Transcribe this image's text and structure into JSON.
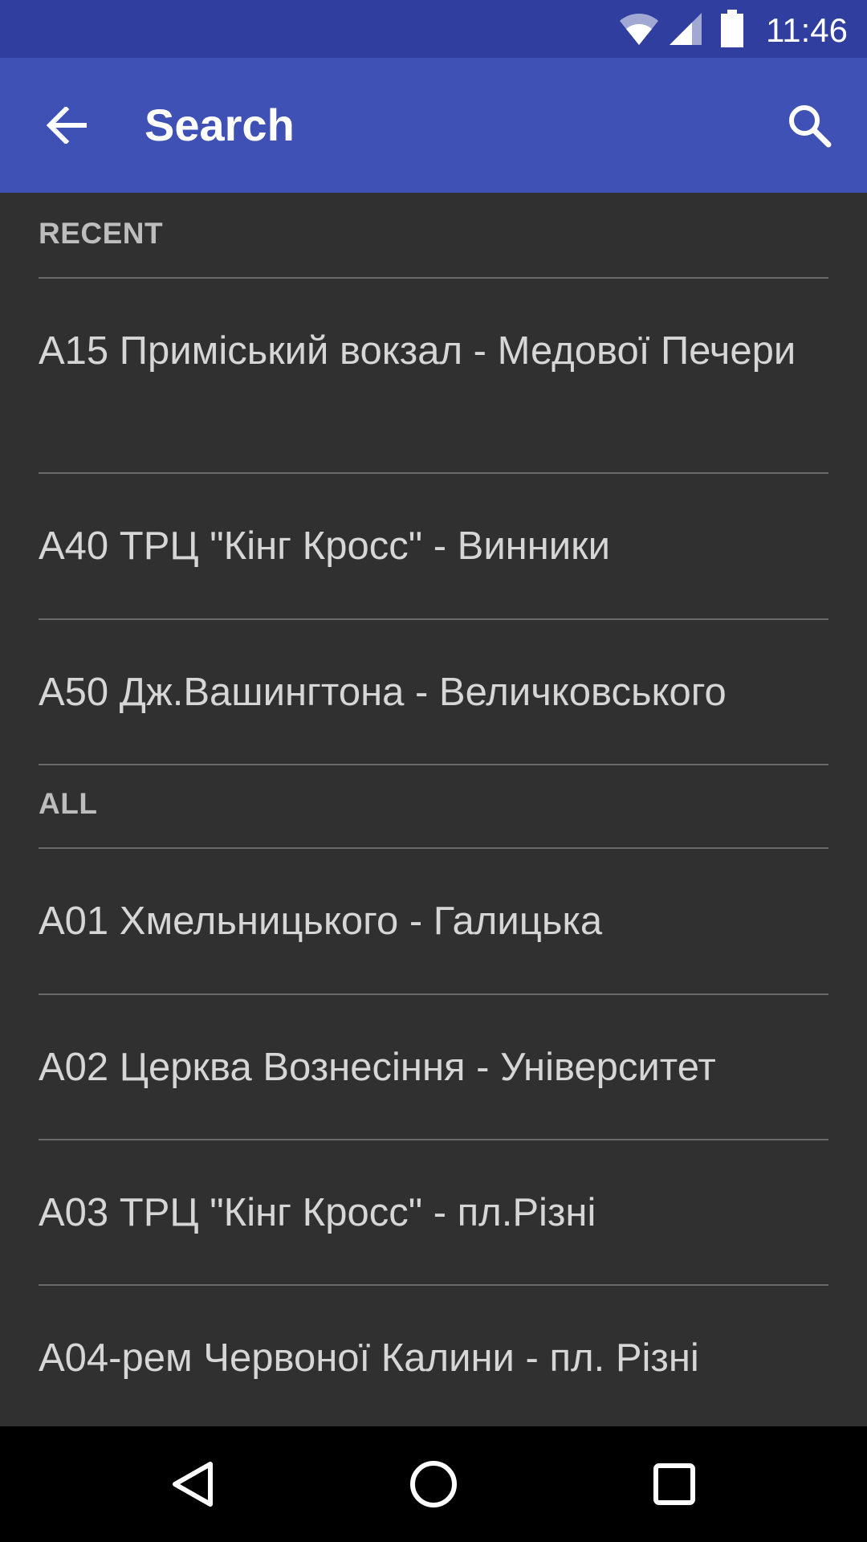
{
  "status_bar": {
    "time": "11:46",
    "icons": [
      "wifi-icon",
      "cell-signal-icon",
      "battery-icon"
    ]
  },
  "toolbar": {
    "title": "Search",
    "back_icon": "arrow-back-icon",
    "search_icon": "search-icon",
    "background_color": "#3f51b5"
  },
  "recent": {
    "header": "RECENT",
    "items": [
      {
        "label": "А15 Приміський вокзал - Медової Печери"
      },
      {
        "label": "А40 ТРЦ \"Кінг Кросс\" - Винники"
      },
      {
        "label": "А50 Дж.Вашингтона - Величковського"
      }
    ]
  },
  "all": {
    "header": "ALL",
    "items": [
      {
        "label": "А01 Хмельницького - Галицька"
      },
      {
        "label": "А02 Церква Вознесіння - Університет"
      },
      {
        "label": "А03 ТРЦ \"Кінг Кросс\" - пл.Різні"
      },
      {
        "label": "А04-рем Червоної Калини - пл. Різні"
      }
    ]
  },
  "nav_bar": {
    "icons": [
      "back-triangle-icon",
      "home-circle-icon",
      "recents-square-icon"
    ]
  }
}
